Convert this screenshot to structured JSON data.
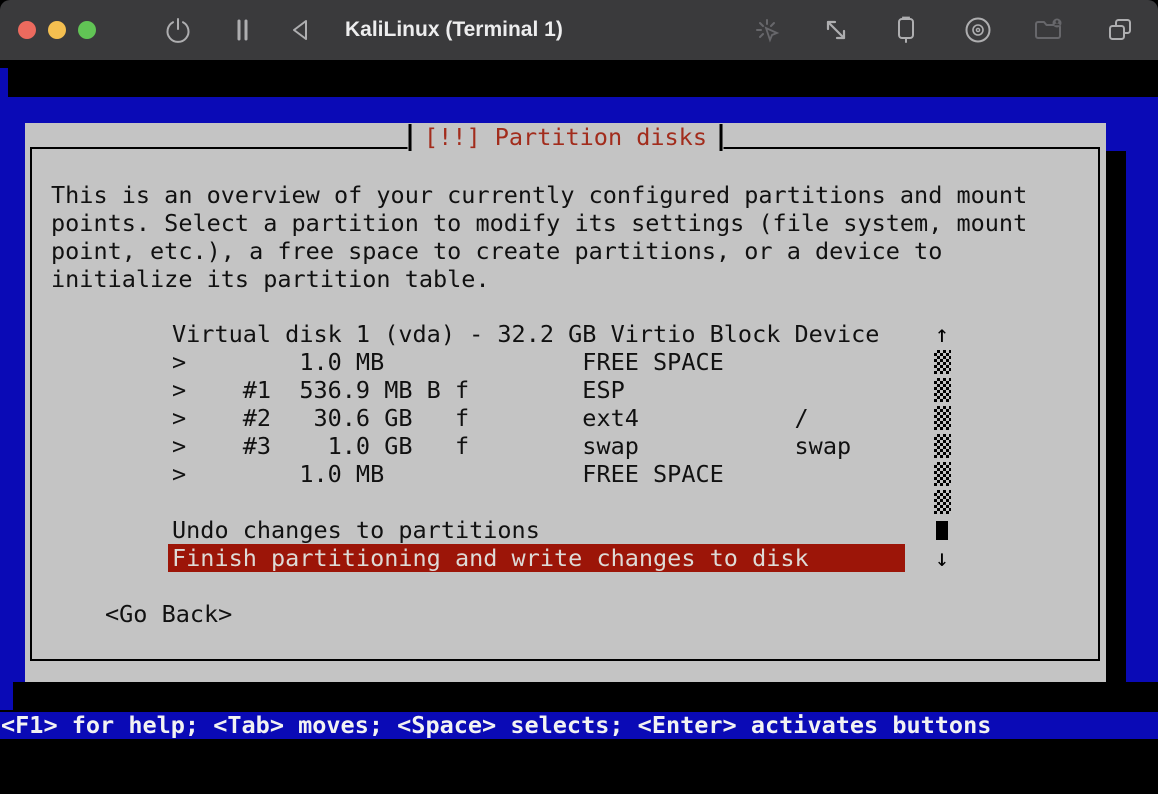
{
  "window": {
    "title": "KaliLinux (Terminal 1)",
    "traffic_lights": {
      "close": "#ec6a5e",
      "minimize": "#f4bf50",
      "zoom": "#61c455"
    },
    "toolbar_icons": [
      "power",
      "pause",
      "play-back",
      "capture-cursor",
      "fullscreen",
      "usb",
      "disc",
      "shared-folder",
      "displays"
    ]
  },
  "colors": {
    "titlebar_bg": "#3a3a3c",
    "screen_blue": "#0a0ab6",
    "dialog_grey": "#c4c4c4",
    "title_red": "#a22c1c",
    "highlight_red": "#9c1508",
    "highlight_text": "#dedad6"
  },
  "installer": {
    "dialog_title": "[!!] Partition disks",
    "intro_lines": [
      "This is an overview of your currently configured partitions and mount",
      "points. Select a partition to modify its settings (file system, mount",
      "point, etc.), a free space to create partitions, or a device to",
      "initialize its partition table."
    ],
    "disk_rows": [
      "Virtual disk 1 (vda) - 32.2 GB Virtio Block Device",
      ">        1.0 MB              FREE SPACE",
      ">    #1  536.9 MB B f        ESP",
      ">    #2   30.6 GB   f        ext4           /",
      ">    #3    1.0 GB   f        swap           swap",
      ">        1.0 MB              FREE SPACE"
    ],
    "partitions": [
      {
        "number": "",
        "size": "1.0 MB",
        "flags": "",
        "fs": "FREE SPACE",
        "mount": ""
      },
      {
        "number": "#1",
        "size": "536.9 MB",
        "flags": "B f",
        "fs": "ESP",
        "mount": ""
      },
      {
        "number": "#2",
        "size": "30.6 GB",
        "flags": "f",
        "fs": "ext4",
        "mount": "/"
      },
      {
        "number": "#3",
        "size": "1.0 GB",
        "flags": "f",
        "fs": "swap",
        "mount": "swap"
      },
      {
        "number": "",
        "size": "1.0 MB",
        "flags": "",
        "fs": "FREE SPACE",
        "mount": ""
      }
    ],
    "disk_summary": {
      "device": "Virtual disk 1 (vda)",
      "size": "32.2 GB",
      "model": "Virtio Block Device"
    },
    "undo_label": "Undo changes to partitions",
    "finish_label": "Finish partitioning and write changes to disk",
    "selected_item": "Finish partitioning and write changes to disk",
    "go_back_label": "<Go Back>",
    "help_line": "<F1> for help; <Tab> moves; <Space> selects; <Enter> activates buttons",
    "scrollbar": {
      "up": "↑",
      "down": "↓"
    }
  }
}
